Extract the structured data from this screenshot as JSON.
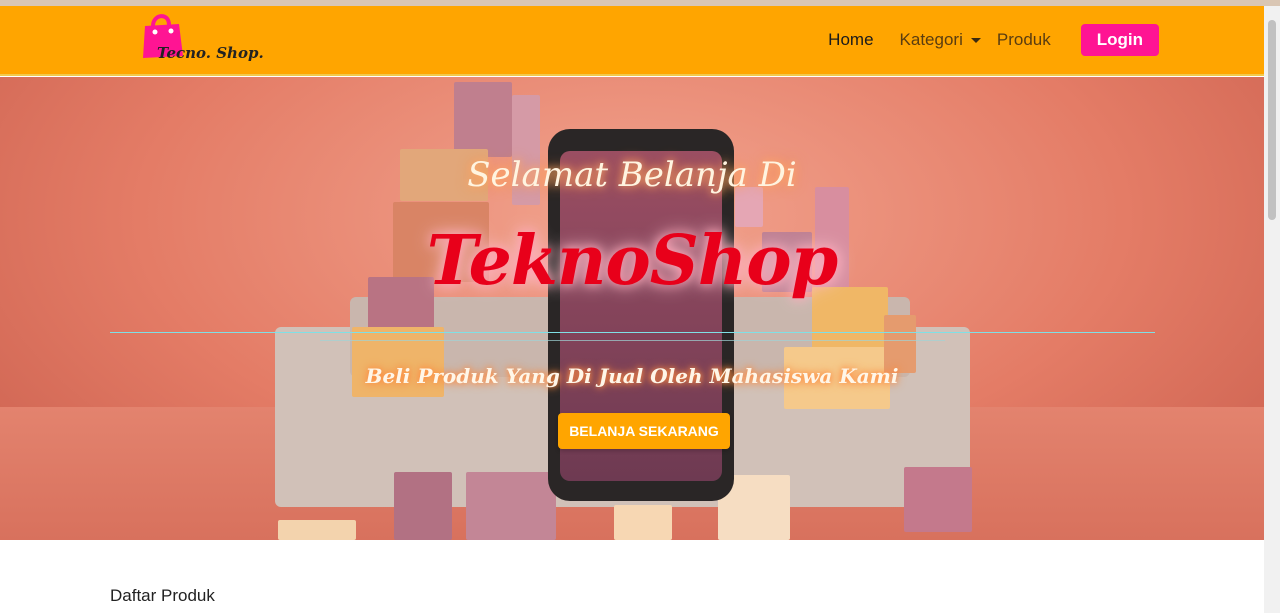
{
  "brand": {
    "logo_text": "Tecno. Shop.",
    "icon": "shopping-bag-icon"
  },
  "nav": {
    "home": "Home",
    "kategori": "Kategori",
    "produk": "Produk",
    "login": "Login"
  },
  "hero": {
    "title_line1": "Selamat Belanja Di",
    "title_line2": "TeknoShop",
    "subtitle": "Beli Produk Yang Di Jual Oleh Mahasiswa Kami",
    "cta_label": "BELANJA SEKARANG"
  },
  "content": {
    "section_title": "Daftar Produk"
  },
  "colors": {
    "navbar": "#ffa500",
    "login_button": "#ff1493",
    "cta_button": "#ffa500",
    "hero_title": "#e8001a"
  }
}
